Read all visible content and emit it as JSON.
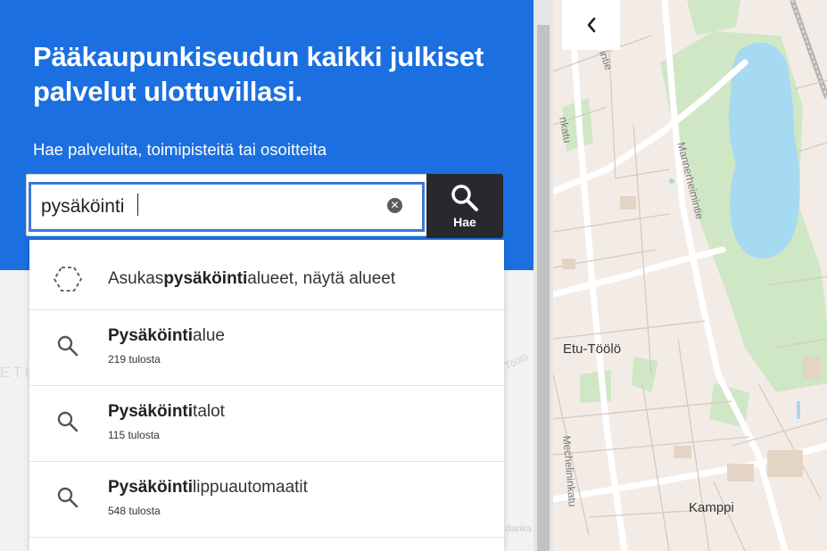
{
  "hero": {
    "title": "Pääkaupunkiseudun kaikki julkiset palvelut ulottuvillasi.",
    "subtitle": "Hae palveluita, toimipisteitä tai osoitteita"
  },
  "search": {
    "value": "pysäköinti",
    "button_label": "Hae",
    "clear_icon": "clear-icon",
    "search_icon": "search-icon"
  },
  "suggestions": [
    {
      "icon": "area-outline-icon",
      "prefix": "Asukas",
      "match": "pysäköinti",
      "suffix": "alueet, näytä alueet"
    },
    {
      "icon": "search-icon",
      "prefix": "",
      "match": "Pysäköinti",
      "suffix": "alue",
      "count": "219 tulosta"
    },
    {
      "icon": "search-icon",
      "prefix": "",
      "match": "Pysäköinti",
      "suffix": "talot",
      "count": "115 tulosta"
    },
    {
      "icon": "search-icon",
      "prefix": "",
      "match": "Pysäköinti",
      "suffix": "lippuautomaatit",
      "count": "548 tulosta"
    }
  ],
  "background_ghost": {
    "left_text": "ETU",
    "right_text": "Töölö",
    "bottom_text": "dianka"
  },
  "map": {
    "collapse_icon": "chevron-left-icon",
    "places": [
      "Etu-Töölö",
      "Kamppi"
    ],
    "streets": [
      "Mannerheimintie",
      "Mechelininkatu",
      "intie",
      "nkatu"
    ],
    "colors": {
      "water": "#a6d9f2",
      "park": "#cfe7c5",
      "road": "#ffffff",
      "block": "#f3ece6"
    }
  },
  "colors": {
    "accent": "#1b6fe0",
    "button_dark": "#27292e",
    "focus_border": "#3a79d8"
  }
}
